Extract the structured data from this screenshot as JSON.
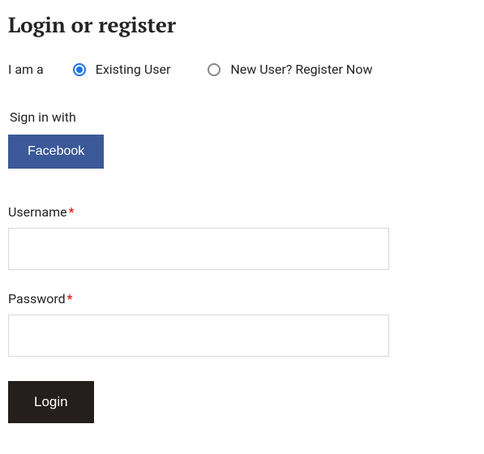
{
  "title": "Login or register",
  "userType": {
    "label": "I am a",
    "options": [
      {
        "label": "Existing User",
        "selected": true
      },
      {
        "label": "New User? Register Now",
        "selected": false
      }
    ]
  },
  "social": {
    "signInWith": "Sign in with",
    "facebook": "Facebook"
  },
  "fields": {
    "username": {
      "label": "Username",
      "required": "*",
      "value": ""
    },
    "password": {
      "label": "Password",
      "required": "*",
      "value": ""
    }
  },
  "loginButton": "Login"
}
